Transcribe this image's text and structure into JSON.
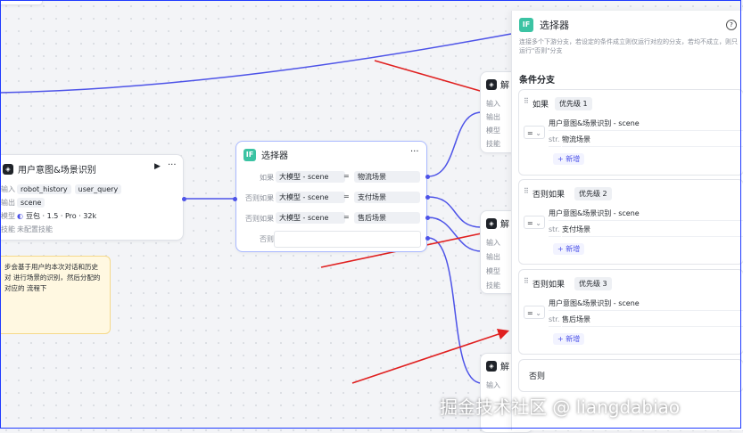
{
  "intent_node": {
    "title": "用户意图&场景识别",
    "input_label": "输入",
    "inputs": [
      "robot_history",
      "user_query"
    ],
    "output_label": "输出",
    "output": "scene",
    "model_label": "模型",
    "model": "豆包 · 1.5 · Pro · 32k",
    "skill_label": "技能",
    "skill_value": "未配置技能"
  },
  "note_text": "步会基于用户的本次对话和历史对 进行场景的识别，然后分配的对应的 流程下",
  "selector_node": {
    "title": "选择器",
    "rows": [
      {
        "label": "如果",
        "left": "大模型 - scene",
        "op": "=",
        "right": "物流场景"
      },
      {
        "label": "否则如果",
        "left": "大模型 - scene",
        "op": "=",
        "right": "支付场景"
      },
      {
        "label": "否则如果",
        "left": "大模型 - scene",
        "op": "=",
        "right": "售后场景"
      },
      {
        "label": "否则",
        "left": "",
        "op": "",
        "right": ""
      }
    ]
  },
  "partial_nodes": [
    {
      "title": "解",
      "rows": [
        "输入",
        "输出",
        "模型",
        "技能"
      ]
    },
    {
      "title": "解",
      "rows": [
        "输入",
        "输出",
        "模型",
        "技能"
      ]
    },
    {
      "title": "解",
      "rows": [
        "输入"
      ]
    }
  ],
  "panel": {
    "title": "选择器",
    "desc": "连接多个下游分支，若设定的条件成立则仅运行对应的分支，若均不成立，则只运行\"否则\"分支",
    "section_title": "条件分支",
    "branches": [
      {
        "label": "如果",
        "priority": "优先级 1",
        "op": "=",
        "var": "用户意图&场景识别 - scene",
        "type": "str.",
        "value": "物流场景",
        "add": "+ 新增"
      },
      {
        "label": "否则如果",
        "priority": "优先级 2",
        "op": "=",
        "var": "用户意图&场景识别 - scene",
        "type": "str.",
        "value": "支付场景",
        "add": "+ 新增"
      },
      {
        "label": "否则如果",
        "priority": "优先级 3",
        "op": "=",
        "var": "用户意图&场景识别 - scene",
        "type": "str.",
        "value": "售后场景",
        "add": "+ 新增"
      }
    ],
    "else_label": "否则"
  },
  "watermark": "掘金技术社区 @ liangdabiao",
  "colors": {
    "accent": "#4d53e8",
    "arrow": "#e02020",
    "if_green": "#3bc3a3"
  }
}
